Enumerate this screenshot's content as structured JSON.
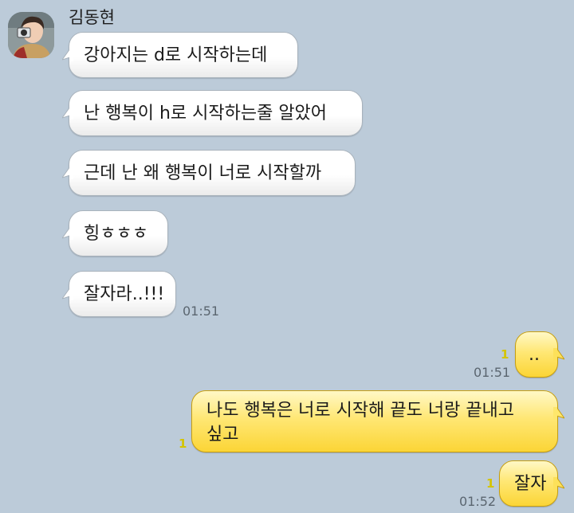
{
  "chat": {
    "sender_name": "김동현",
    "incoming": [
      {
        "text": "강아지는 d로 시작하는데"
      },
      {
        "text": "난 행복이 h로 시작하는줄 알았어"
      },
      {
        "text": "근데 난 왜 행복이 너로 시작할까"
      },
      {
        "text": "힝ㅎㅎㅎ"
      },
      {
        "text": "잘자라..!!!",
        "time": "01:51"
      }
    ],
    "outgoing": [
      {
        "text": "..",
        "time": "01:51",
        "unread": "1"
      },
      {
        "line1": "나도 행복은 너로 시작해 끝도 너랑 끝내고",
        "line2": "싶고",
        "unread": "1"
      },
      {
        "text": "잘자",
        "time": "01:52",
        "unread": "1"
      }
    ]
  },
  "colors": {
    "background": "#bccbd9",
    "incoming_bubble": "#ffffff",
    "outgoing_bubble": "#ffe774",
    "unread_count": "#d4c400"
  }
}
